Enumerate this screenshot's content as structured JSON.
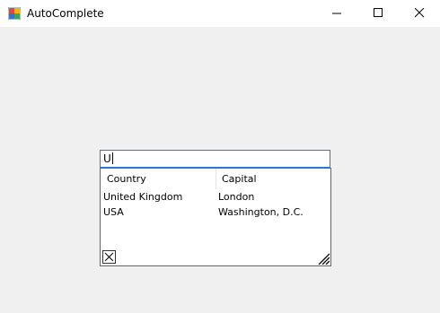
{
  "window": {
    "title": "AutoComplete",
    "app_icon": "windows-forms-app-icon",
    "controls": [
      "minimize-icon",
      "maximize-icon",
      "close-icon"
    ]
  },
  "autocomplete": {
    "input_value": "U"
  },
  "popup": {
    "columns": [
      "Country",
      "Capital"
    ],
    "rows": [
      [
        "United Kingdom",
        "London"
      ],
      [
        "USA",
        "Washington, D.C."
      ]
    ],
    "close_icon": "close-box-icon",
    "resize_icon": "resize-grip-icon"
  }
}
